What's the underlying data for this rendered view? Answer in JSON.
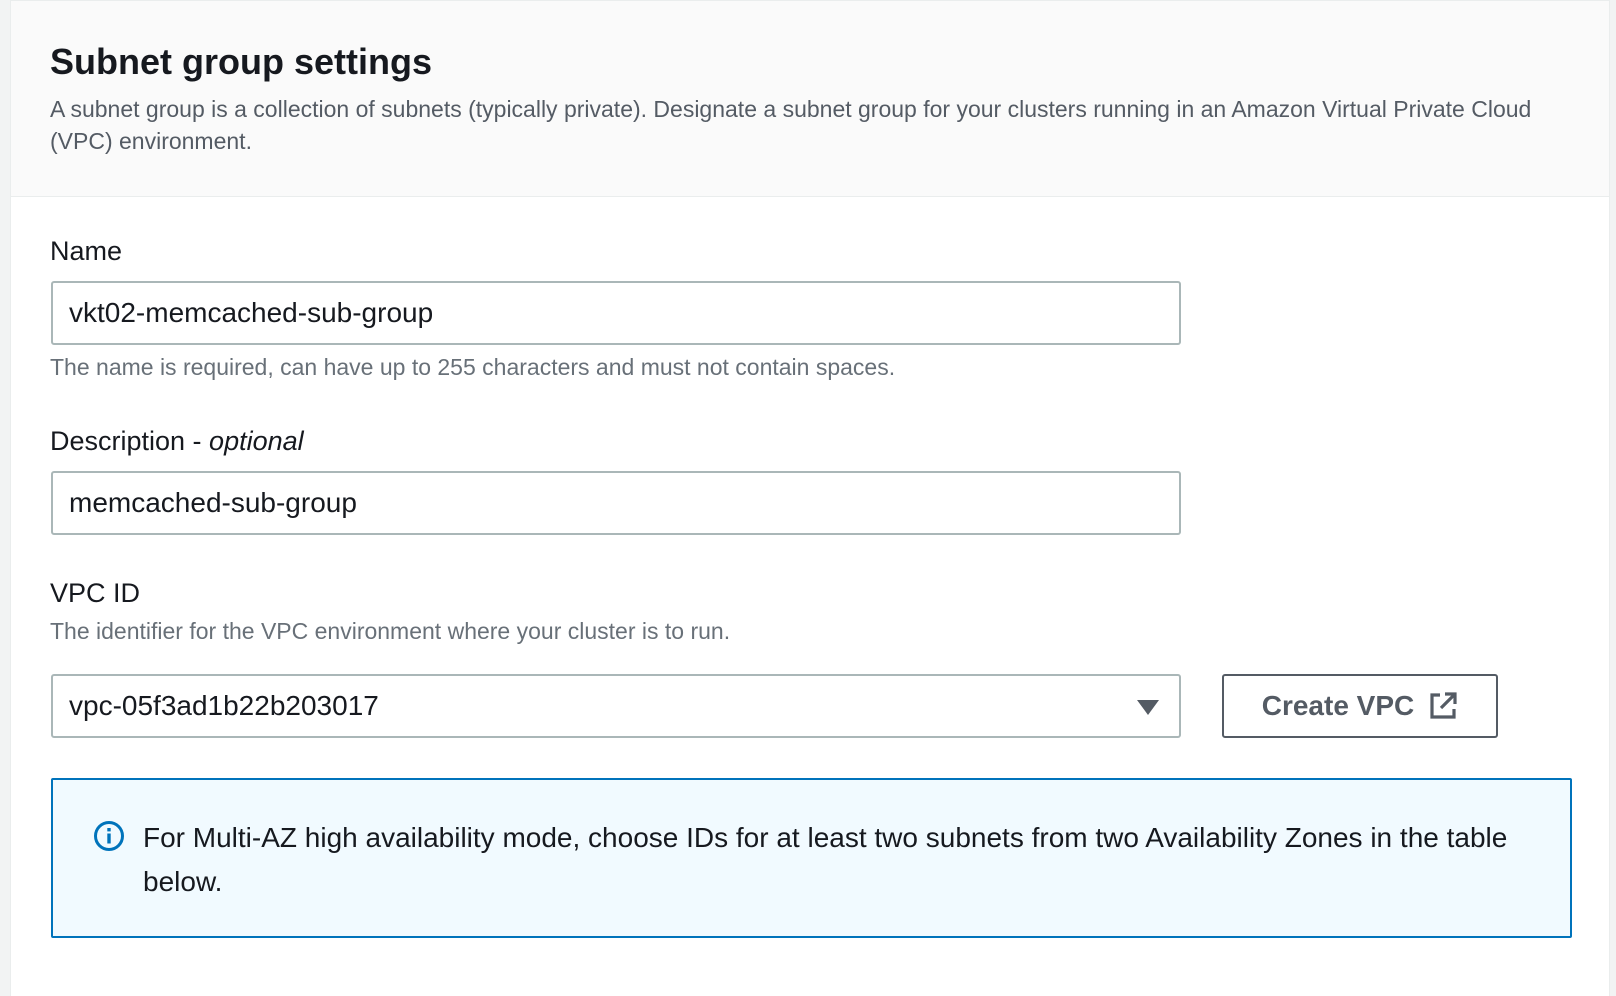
{
  "section": {
    "title": "Subnet group settings",
    "description": "A subnet group is a collection of subnets (typically private). Designate a subnet group for your clusters running in an Amazon Virtual Private Cloud (VPC) environment."
  },
  "name_field": {
    "label": "Name",
    "value": "vkt02-memcached-sub-group",
    "hint": "The name is required, can have up to 255 characters and must not contain spaces."
  },
  "description_field": {
    "label": "Description - ",
    "label_optional": "optional",
    "value": "memcached-sub-group"
  },
  "vpc_field": {
    "label": "VPC ID",
    "hint": "The identifier for the VPC environment where your cluster is to run.",
    "selected": "vpc-05f3ad1b22b203017",
    "create_button": "Create VPC"
  },
  "info_alert": {
    "text": "For Multi-AZ high availability mode, choose IDs for at least two subnets from two Availability Zones in the table below."
  },
  "colors": {
    "info_border": "#0073bb",
    "info_background": "#f1faff",
    "input_border": "#aab7b8"
  },
  "icons": {
    "external_link": "external-link-icon",
    "info": "info-icon",
    "dropdown": "caret-down-icon"
  }
}
